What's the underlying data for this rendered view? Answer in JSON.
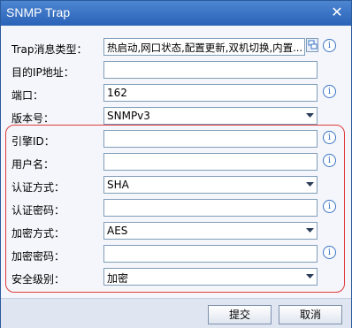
{
  "dialog": {
    "title": "SNMP Trap",
    "close_label": "✕"
  },
  "form": {
    "trap_type": {
      "label": "Trap消息类型：",
      "value": "热启动,网口状态,配置更新,双机切换,内置..."
    },
    "target_ip": {
      "label": "目的IP地址：",
      "value": ""
    },
    "port": {
      "label": "端口：",
      "value": "162"
    },
    "version": {
      "label": "版本号：",
      "value": "SNMPv3"
    },
    "engine_id": {
      "label": "引擎ID：",
      "value": ""
    },
    "username": {
      "label": "用户名：",
      "value": ""
    },
    "auth_method": {
      "label": "认证方式：",
      "value": "SHA"
    },
    "auth_password": {
      "label": "认证密码：",
      "value": ""
    },
    "encrypt_method": {
      "label": "加密方式：",
      "value": "AES"
    },
    "encrypt_password": {
      "label": "加密密码：",
      "value": ""
    },
    "security_level": {
      "label": "安全级别：",
      "value": "加密"
    }
  },
  "info_icon_text": "i",
  "footer": {
    "submit_label": "提交",
    "cancel_label": "取消"
  },
  "colors": {
    "titlebar": "#2a62b8",
    "highlight_border": "#e03b3b",
    "info_icon": "#3a74c5"
  }
}
